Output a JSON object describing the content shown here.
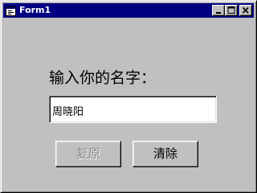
{
  "window": {
    "title": "Form1",
    "colors": {
      "face": "#c0c0c0",
      "titlebar": "#000080",
      "title_text": "#ffffff",
      "disabled_text": "#808080"
    }
  },
  "titlebar_icons": {
    "app": "form-icon",
    "minimize": "minimize-icon",
    "maximize": "maximize-icon",
    "close": "close-icon"
  },
  "form": {
    "prompt_label": "输入你的名字：",
    "name_value": "周晓阳",
    "restore_button": {
      "label": "复原",
      "enabled": false
    },
    "clear_button": {
      "label": "清除",
      "enabled": true
    }
  }
}
